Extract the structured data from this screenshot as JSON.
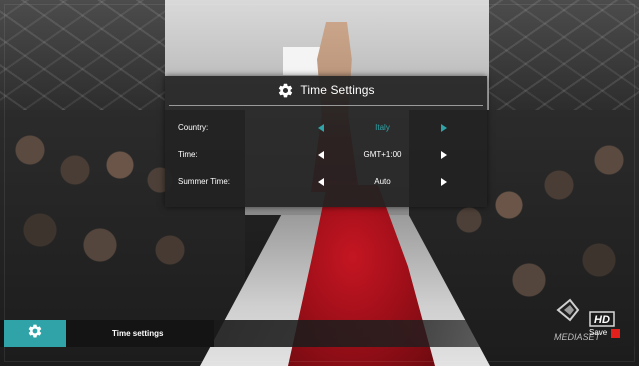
{
  "dialog": {
    "title": "Time Settings",
    "icon": "gear-icon",
    "rows": [
      {
        "label": "Country:",
        "value": "Italy",
        "active": true
      },
      {
        "label": "Time:",
        "value": "GMT+1:00",
        "active": false
      },
      {
        "label": "Summer Time:",
        "value": "Auto",
        "active": false
      }
    ]
  },
  "bottom_bar": {
    "icon": "gear-icon",
    "title": "Time settings"
  },
  "logo": {
    "text": "MEDIASET",
    "badge": "HD"
  },
  "save": {
    "label": "Save",
    "color": "#e3201b"
  },
  "colors": {
    "accent": "#2fa3a7",
    "dialog_bg": "#222222",
    "text": "#ffffff"
  }
}
